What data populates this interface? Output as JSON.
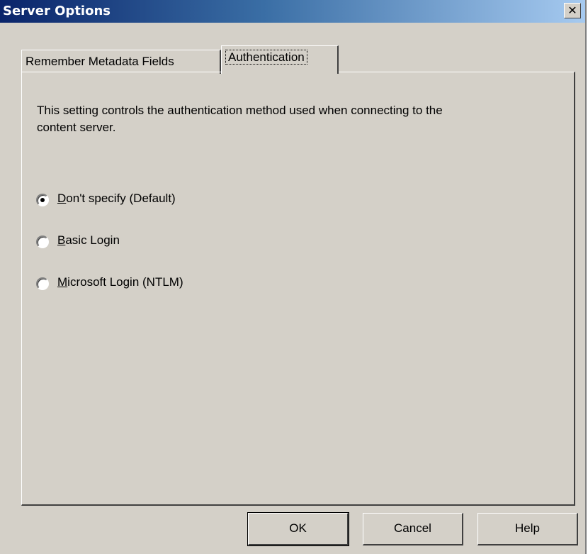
{
  "window": {
    "title": "Server Options",
    "close_label": "✕"
  },
  "tabs": [
    {
      "label": "Remember Metadata Fields",
      "selected": false
    },
    {
      "label": "Authentication",
      "selected": true
    }
  ],
  "panel": {
    "description": "This setting controls the authentication method used when connecting to the content server.",
    "options": [
      {
        "mnemonic": "D",
        "rest": "on't specify (Default)",
        "checked": true
      },
      {
        "mnemonic": "B",
        "rest": "asic Login",
        "checked": false
      },
      {
        "mnemonic": "M",
        "rest": "icrosoft Login (NTLM)",
        "checked": false
      }
    ]
  },
  "buttons": {
    "ok": "OK",
    "cancel": "Cancel",
    "help": "Help"
  }
}
